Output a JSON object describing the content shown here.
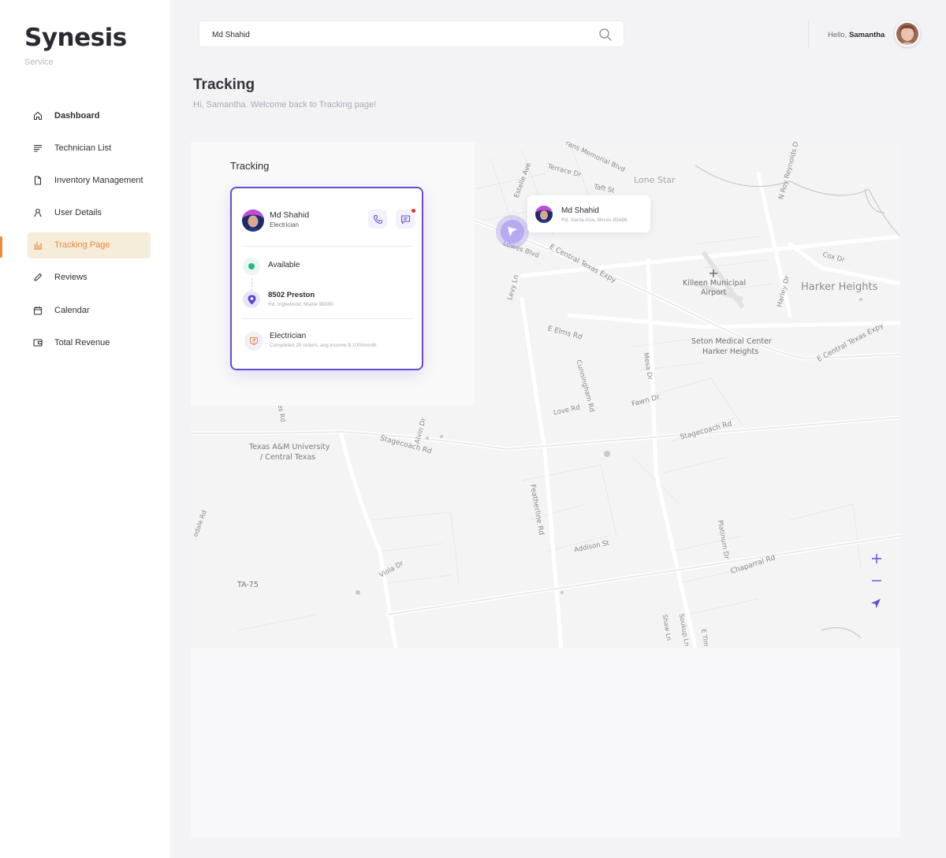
{
  "brand": {
    "name": "Synesis",
    "subtitle": "Service"
  },
  "nav": {
    "items": [
      {
        "label": "Dashboard",
        "icon": "home-icon"
      },
      {
        "label": "Technician List",
        "icon": "list-icon"
      },
      {
        "label": "Inventory Management",
        "icon": "document-icon"
      },
      {
        "label": "User Details",
        "icon": "user-icon"
      },
      {
        "label": "Tracking Page",
        "icon": "chart-icon",
        "active": true
      },
      {
        "label": "Reviews",
        "icon": "pencil-icon"
      },
      {
        "label": "Calendar",
        "icon": "calendar-icon"
      },
      {
        "label": "Total Revenue",
        "icon": "wallet-icon"
      }
    ]
  },
  "search": {
    "value": "Md Shahid",
    "icon": "search-icon"
  },
  "user": {
    "greeting": "Hello,",
    "name": "Samantha"
  },
  "page": {
    "title": "Tracking",
    "subtitle": "Hi, Samantha. Welcome back  to  Tracking page!"
  },
  "tracking": {
    "title": "Tracking",
    "technician": {
      "name": "Md Shahid",
      "role": "Electrician"
    },
    "status": "Available",
    "address": {
      "line1": "8502 Preston",
      "line2": "Rd. Inglewood, Maine 98380"
    },
    "job": {
      "title": "Electrician",
      "detail": "Completed 20 orders, avg income $ 100/month"
    }
  },
  "map": {
    "popup": {
      "name": "Md Shahid",
      "address": "Rd. Santa Ana, Illinois 85486"
    },
    "labels": {
      "lone_star": "Lone Star",
      "harker_heights": "Harker Heights",
      "killeen_airport_1": "Killeen Municipal",
      "killeen_airport_2": "Airport",
      "seton_1": "Seton Medical Center",
      "seton_2": "Harker Heights",
      "tamu_1": "Texas A&M University",
      "tamu_2": "/ Central Texas",
      "memorial": "rans Memorial Blvd",
      "terrace": "Terrace Dr",
      "taft": "Taft St",
      "estelle": "Estelle Ave",
      "lowes": "Lowes Blvd",
      "e_central": "E Central Texas Expy",
      "e_central_2": "E Central Texas Expy",
      "cox": "Cox Dr",
      "n_roy": "N Roy Reynolds Dr",
      "harley": "Harley Dr",
      "levy": "Levy Ln",
      "e_elms": "E Elms Rd",
      "mesa": "Mesa Dr",
      "cunningham": "Cunningham Rd",
      "love": "Love Rd",
      "fawn": "Fawn Dr",
      "stagecoach_1": "Stagecoach Rd",
      "stagecoach_2": "Stagecoach Rd",
      "alvin": "Alvin Dr",
      "featherline": "Featherline Rd",
      "addison": "Addison St",
      "platinum": "Platinum Dr",
      "chaparral": "Chaparral Rd",
      "viola": "Viola Dr",
      "ta75": "TA-75",
      "shaw": "Shaw Ln",
      "sonkup": "Soukup Ln",
      "e_tim": "E Tim",
      "hodale": "odale Rd",
      "es_rd": "es Rd"
    }
  }
}
